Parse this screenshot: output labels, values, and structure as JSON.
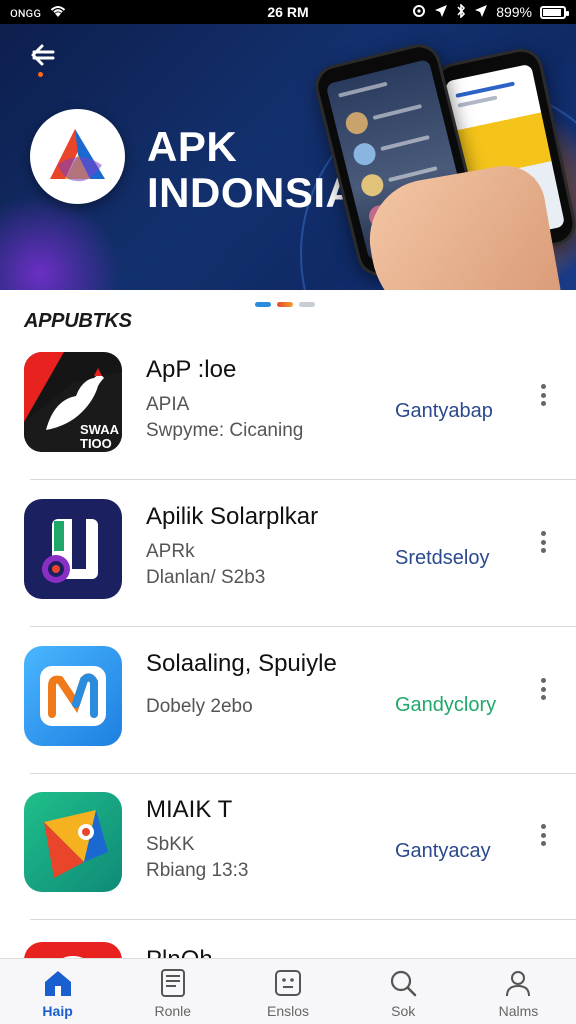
{
  "status_bar": {
    "carrier": "ᴏɴɢɢ",
    "time": "26 RM",
    "battery": "899%",
    "battery_level": 0.9
  },
  "hero": {
    "title_line1": "APK",
    "title_line2": "INDONSIA",
    "back_icon": "back-arrow-icon",
    "active_slide": 1,
    "slide_count": 3
  },
  "section": {
    "title": "APPUBTKS"
  },
  "apps": [
    {
      "name": "ApP :loe",
      "sub1": "APIA",
      "sub2": "Swpyme: Cicaning",
      "category": "Gantyabap",
      "category_color": "#2a4a8c",
      "icon": "rooster-app-icon"
    },
    {
      "name": "Apilik Solarplkar",
      "sub1": "APRk",
      "sub2": "Dlanlan/ S2b3",
      "category": "Sretdseloy",
      "category_color": "#2a4a8c",
      "icon": "player-app-icon"
    },
    {
      "name": "Solaaling, Spuiyle",
      "sub1": "Dobely 2ebo",
      "sub2": "",
      "category": "Gandyclory",
      "category_color": "#1fa86a",
      "icon": "n-app-icon"
    },
    {
      "name": "MIAIK T",
      "sub1": "SbKK",
      "sub2": "Rbiang 13:3",
      "category": "Gantyacay",
      "category_color": "#2a4a8c",
      "icon": "kite-app-icon"
    },
    {
      "name": "PlnQh",
      "sub1": "",
      "sub2": "",
      "category": "",
      "category_color": "#2a4a8c",
      "icon": "whatsapp-app-icon"
    }
  ],
  "bottom_nav": [
    {
      "label": "Haip",
      "icon": "home-icon",
      "active": true
    },
    {
      "label": "Ronle",
      "icon": "document-icon",
      "active": false
    },
    {
      "label": "Enslos",
      "icon": "face-box-icon",
      "active": false
    },
    {
      "label": "Sok",
      "icon": "search-icon",
      "active": false
    },
    {
      "label": "Nalms",
      "icon": "profile-icon",
      "active": false
    }
  ],
  "colors": {
    "accent": "#1a5fd0",
    "hero_bg": "#13306e",
    "indicator_active": "#2b8bdc",
    "indicator_2": "#f0a030"
  }
}
